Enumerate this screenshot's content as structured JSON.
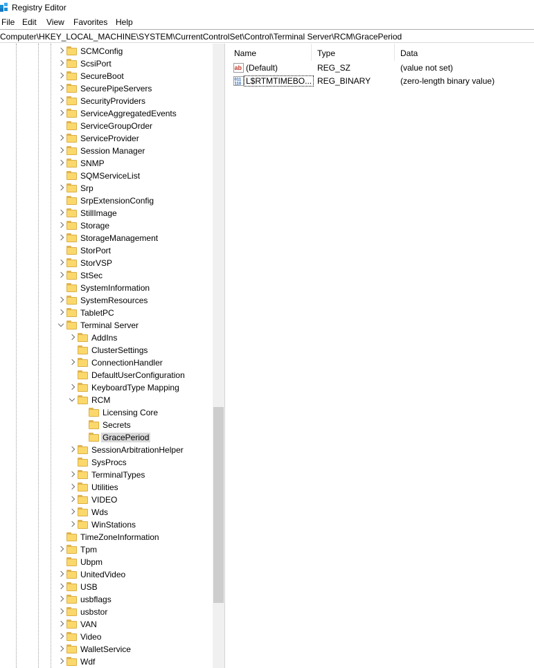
{
  "window": {
    "title": "Registry Editor"
  },
  "menu": [
    "File",
    "Edit",
    "View",
    "Favorites",
    "Help"
  ],
  "address": "Computer\\HKEY_LOCAL_MACHINE\\SYSTEM\\CurrentControlSet\\Control\\Terminal Server\\RCM\\GracePeriod",
  "tree": [
    {
      "label": "SCMConfig",
      "level": 0,
      "exp": "closed"
    },
    {
      "label": "ScsiPort",
      "level": 0,
      "exp": "closed"
    },
    {
      "label": "SecureBoot",
      "level": 0,
      "exp": "closed"
    },
    {
      "label": "SecurePipeServers",
      "level": 0,
      "exp": "closed"
    },
    {
      "label": "SecurityProviders",
      "level": 0,
      "exp": "closed"
    },
    {
      "label": "ServiceAggregatedEvents",
      "level": 0,
      "exp": "closed"
    },
    {
      "label": "ServiceGroupOrder",
      "level": 0,
      "exp": "none"
    },
    {
      "label": "ServiceProvider",
      "level": 0,
      "exp": "closed"
    },
    {
      "label": "Session Manager",
      "level": 0,
      "exp": "closed"
    },
    {
      "label": "SNMP",
      "level": 0,
      "exp": "closed"
    },
    {
      "label": "SQMServiceList",
      "level": 0,
      "exp": "none"
    },
    {
      "label": "Srp",
      "level": 0,
      "exp": "closed"
    },
    {
      "label": "SrpExtensionConfig",
      "level": 0,
      "exp": "none"
    },
    {
      "label": "StillImage",
      "level": 0,
      "exp": "closed"
    },
    {
      "label": "Storage",
      "level": 0,
      "exp": "closed"
    },
    {
      "label": "StorageManagement",
      "level": 0,
      "exp": "closed"
    },
    {
      "label": "StorPort",
      "level": 0,
      "exp": "none"
    },
    {
      "label": "StorVSP",
      "level": 0,
      "exp": "closed"
    },
    {
      "label": "StSec",
      "level": 0,
      "exp": "closed"
    },
    {
      "label": "SystemInformation",
      "level": 0,
      "exp": "none"
    },
    {
      "label": "SystemResources",
      "level": 0,
      "exp": "closed"
    },
    {
      "label": "TabletPC",
      "level": 0,
      "exp": "closed"
    },
    {
      "label": "Terminal Server",
      "level": 0,
      "exp": "open"
    },
    {
      "label": "AddIns",
      "level": 1,
      "exp": "closed"
    },
    {
      "label": "ClusterSettings",
      "level": 1,
      "exp": "none"
    },
    {
      "label": "ConnectionHandler",
      "level": 1,
      "exp": "closed"
    },
    {
      "label": "DefaultUserConfiguration",
      "level": 1,
      "exp": "none"
    },
    {
      "label": "KeyboardType Mapping",
      "level": 1,
      "exp": "closed"
    },
    {
      "label": "RCM",
      "level": 1,
      "exp": "open"
    },
    {
      "label": "Licensing Core",
      "level": 2,
      "exp": "none"
    },
    {
      "label": "Secrets",
      "level": 2,
      "exp": "none"
    },
    {
      "label": "GracePeriod",
      "level": 2,
      "exp": "none",
      "selected": true
    },
    {
      "label": "SessionArbitrationHelper",
      "level": 1,
      "exp": "closed"
    },
    {
      "label": "SysProcs",
      "level": 1,
      "exp": "none"
    },
    {
      "label": "TerminalTypes",
      "level": 1,
      "exp": "closed"
    },
    {
      "label": "Utilities",
      "level": 1,
      "exp": "closed"
    },
    {
      "label": "VIDEO",
      "level": 1,
      "exp": "closed"
    },
    {
      "label": "Wds",
      "level": 1,
      "exp": "closed"
    },
    {
      "label": "WinStations",
      "level": 1,
      "exp": "closed"
    },
    {
      "label": "TimeZoneInformation",
      "level": 0,
      "exp": "none"
    },
    {
      "label": "Tpm",
      "level": 0,
      "exp": "closed"
    },
    {
      "label": "Ubpm",
      "level": 0,
      "exp": "none"
    },
    {
      "label": "UnitedVideo",
      "level": 0,
      "exp": "closed"
    },
    {
      "label": "USB",
      "level": 0,
      "exp": "closed"
    },
    {
      "label": "usbflags",
      "level": 0,
      "exp": "closed"
    },
    {
      "label": "usbstor",
      "level": 0,
      "exp": "closed"
    },
    {
      "label": "VAN",
      "level": 0,
      "exp": "closed"
    },
    {
      "label": "Video",
      "level": 0,
      "exp": "closed"
    },
    {
      "label": "WalletService",
      "level": 0,
      "exp": "closed"
    },
    {
      "label": "Wdf",
      "level": 0,
      "exp": "closed"
    }
  ],
  "list": {
    "columns": [
      "Name",
      "Type",
      "Data"
    ],
    "rows": [
      {
        "icon": "string-value-icon",
        "name": "(Default)",
        "type": "REG_SZ",
        "data": "(value not set)"
      },
      {
        "icon": "binary-value-icon",
        "name": "L$RTMTIMEBO...",
        "type": "REG_BINARY",
        "data": "(zero-length binary value)",
        "focused": true
      }
    ]
  },
  "colors": {
    "folder": "#fbd86b",
    "selection": "#d9d9d9",
    "titleIcon": "#1a8fd6"
  }
}
